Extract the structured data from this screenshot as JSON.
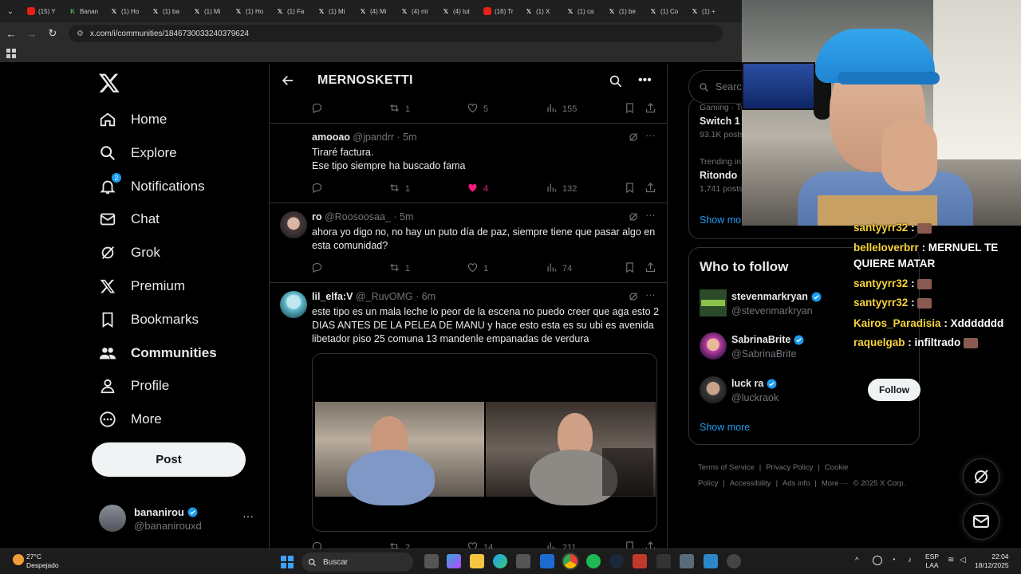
{
  "browser": {
    "tabs": [
      {
        "label": "(15) Y",
        "icon": "youtube-icon"
      },
      {
        "label": "Banan",
        "icon": "bookmark-icon"
      },
      {
        "label": "(1) Ho",
        "icon": "x-icon"
      },
      {
        "label": "(1) ba",
        "icon": "x-icon"
      },
      {
        "label": "(1) Mi",
        "icon": "x-icon"
      },
      {
        "label": "(1) Ho",
        "icon": "x-icon"
      },
      {
        "label": "(1) Fa",
        "icon": "x-icon"
      },
      {
        "label": "(1) Mi",
        "icon": "x-icon"
      },
      {
        "label": "(4) Mi",
        "icon": "x-icon"
      },
      {
        "label": "(4) mi",
        "icon": "x-icon"
      },
      {
        "label": "(4) tut",
        "icon": "x-icon"
      },
      {
        "label": "(16) Tr",
        "icon": "youtube-icon"
      },
      {
        "label": "(1) X",
        "icon": "x-icon"
      },
      {
        "label": "(1) ca",
        "icon": "x-icon"
      },
      {
        "label": "(1) be",
        "icon": "x-icon"
      },
      {
        "label": "(1) Co",
        "icon": "x-icon"
      },
      {
        "label": "(1) +",
        "icon": "x-icon"
      }
    ],
    "url": "x.com/i/communities/1846730033240379624"
  },
  "nav": {
    "items": [
      {
        "label": "Home",
        "icon": "home-icon"
      },
      {
        "label": "Explore",
        "icon": "search-icon"
      },
      {
        "label": "Notifications",
        "icon": "bell-icon",
        "badge": "2"
      },
      {
        "label": "Chat",
        "icon": "envelope-icon"
      },
      {
        "label": "Grok",
        "icon": "grok-icon"
      },
      {
        "label": "Premium",
        "icon": "x-icon"
      },
      {
        "label": "Bookmarks",
        "icon": "bookmark-icon"
      },
      {
        "label": "Communities",
        "icon": "people-icon"
      },
      {
        "label": "Profile",
        "icon": "person-icon"
      },
      {
        "label": "More",
        "icon": "more-circle-icon"
      }
    ],
    "post_label": "Post",
    "account": {
      "name": "bananirou",
      "handle": "@bananirouxd"
    }
  },
  "main": {
    "title": "MERNOSKETTI",
    "top_actions": {
      "replies": "",
      "reposts": "1",
      "likes": "5",
      "views": "155"
    },
    "tweets": [
      {
        "name": "amooao",
        "handle": "@jpandrr",
        "time": "· 5m",
        "lines": [
          "Tiraré factura.",
          "Ese tipo siempre ha buscado fama"
        ],
        "reposts": "1",
        "likes": "4",
        "views": "132",
        "liked": true
      },
      {
        "name": "ro",
        "handle": "@Roosoosaa_",
        "time": "· 5m",
        "lines": [
          "ahora yo digo no, no hay un puto día de paz, siempre tiene que pasar algo en esta comunidad?"
        ],
        "reposts": "1",
        "likes": "1",
        "views": "74",
        "liked": false
      },
      {
        "name": "lil_elfa:V",
        "handle": "@_RuvOMG",
        "time": "· 6m",
        "lines": [
          "este tipo es un mala leche lo peor de la escena no puedo creer que aga esto 2 DIAS ANTES DE LA PELEA DE MANU y hace esto esta es su ubi es avenida libetador piso 25 comuna 13 mandenle empanadas de verdura"
        ],
        "reposts": "2",
        "likes": "14",
        "views": "211",
        "liked": false
      }
    ]
  },
  "right": {
    "search_placeholder": "Search",
    "trends": [
      {
        "category": "Gaming · Tr",
        "name": "Switch 1",
        "count": "93.1K posts"
      },
      {
        "category": "Trending in",
        "name": "Ritondo",
        "count": "1,741 posts"
      }
    ],
    "show_more": "Show mo",
    "who_to_follow": {
      "title": "Who to follow",
      "users": [
        {
          "name": "stevenmarkryan",
          "handle": "@stevenmarkryan"
        },
        {
          "name": "SabrinaBrite",
          "handle": "@SabrinaBrite"
        },
        {
          "name": "luck ra",
          "handle": "@luckraok",
          "button": "Follow"
        }
      ],
      "show_more": "Show more"
    },
    "footer": [
      "Terms of Service",
      "|",
      "Privacy Policy",
      "|",
      "Cookie Policy",
      "|",
      "Accessibility",
      "|",
      "Ads info",
      "|",
      "More ···",
      "© 2025 X Corp."
    ]
  },
  "stream_chat": [
    {
      "user": "santyyrr32",
      "text": ":"
    },
    {
      "user": "belleloverbrr",
      "text": ": MERNUEL TE"
    },
    {
      "user": "",
      "text": "QUIERE MATAR"
    },
    {
      "user": "santyyrr32",
      "text": ":"
    },
    {
      "user": "santyyrr32",
      "text": ":"
    },
    {
      "user": "Kairos_Paradisia",
      "text": ": Xddddddd"
    },
    {
      "user": "raquelgab",
      "text": ": infiltrado"
    }
  ],
  "taskbar": {
    "weather_temp": "27°C",
    "weather_desc": "Despejado",
    "search_label": "Buscar",
    "lang": "ESP",
    "lang_sub": "LAA",
    "time": "22:04",
    "date": "18/12/2025"
  },
  "colors": {
    "accent": "#1d9bf0",
    "like": "#f91880",
    "chat_user": "#f6d33c"
  }
}
